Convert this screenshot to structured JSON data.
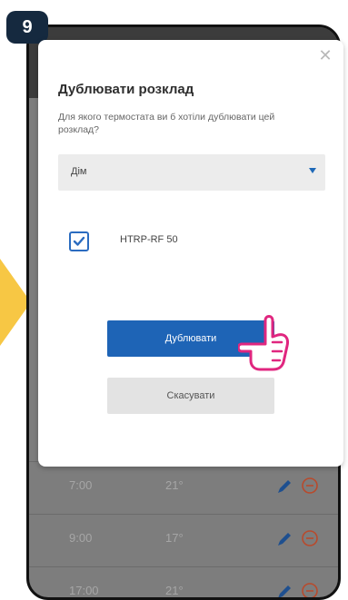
{
  "step": {
    "number": "9"
  },
  "dialog": {
    "title": "Дублювати розклад",
    "description": "Для якого термостата ви б хотіли дублювати цей розклад?",
    "location_select": {
      "value": "Дім"
    },
    "thermostat": {
      "name": "HTRP-RF 50",
      "checked": true
    },
    "duplicate_button": "Дублювати",
    "cancel_button": "Скасувати"
  },
  "background_schedule": [
    {
      "time": "7:00",
      "temp": "21°"
    },
    {
      "time": "9:00",
      "temp": "17°"
    },
    {
      "time": "17:00",
      "temp": "21°"
    }
  ],
  "colors": {
    "primary": "#1e64b6",
    "badge": "#15293f",
    "arrow": "#f7c744",
    "pointer": "#e0267f"
  },
  "icons": {
    "close": "close-icon",
    "dropdown": "chevron-down-icon",
    "checkbox": "checkmark-icon",
    "hand": "pointing-hand-icon",
    "edit": "pencil-icon",
    "remove": "minus-circle-icon"
  }
}
